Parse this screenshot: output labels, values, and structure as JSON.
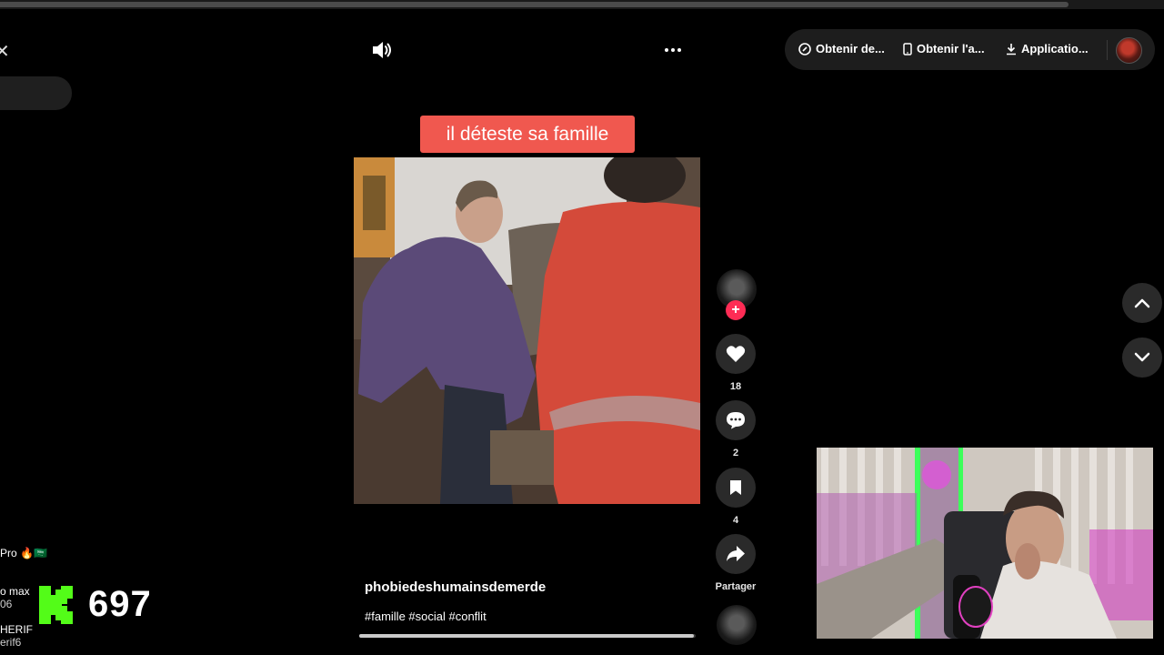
{
  "top_bar": {
    "sound_icon": "speaker-on-icon",
    "more_icon": "ellipsis-icon"
  },
  "header_pill": {
    "items": [
      {
        "label": "Obtenir de...",
        "icon": "coin-icon"
      },
      {
        "label": "Obtenir l'a...",
        "icon": "phone-icon"
      },
      {
        "label": "Applicatio...",
        "icon": "download-icon"
      }
    ],
    "avatar": "profile-avatar"
  },
  "video": {
    "caption": "il déteste sa famille",
    "username": "phobiedeshumainsdemerde",
    "hashtags": "#famille #social #conflit",
    "progress": 0.995
  },
  "actions": {
    "likes": "18",
    "comments": "2",
    "saves": "4",
    "share_label": "Partager"
  },
  "sidebar_left": {
    "rows": [
      {
        "text": "Pro 🔥🇸🇦",
        "sub": ""
      },
      {
        "text": "o max",
        "sub": "06"
      },
      {
        "text": "HERIF",
        "sub": "erif6"
      }
    ]
  },
  "kick_overlay": {
    "viewer_count": "697",
    "brand_color": "#53fc18"
  },
  "colors": {
    "caption_bg": "#f0584f",
    "follow_bg": "#fe2c55",
    "button_bg": "#2a2a2a"
  }
}
